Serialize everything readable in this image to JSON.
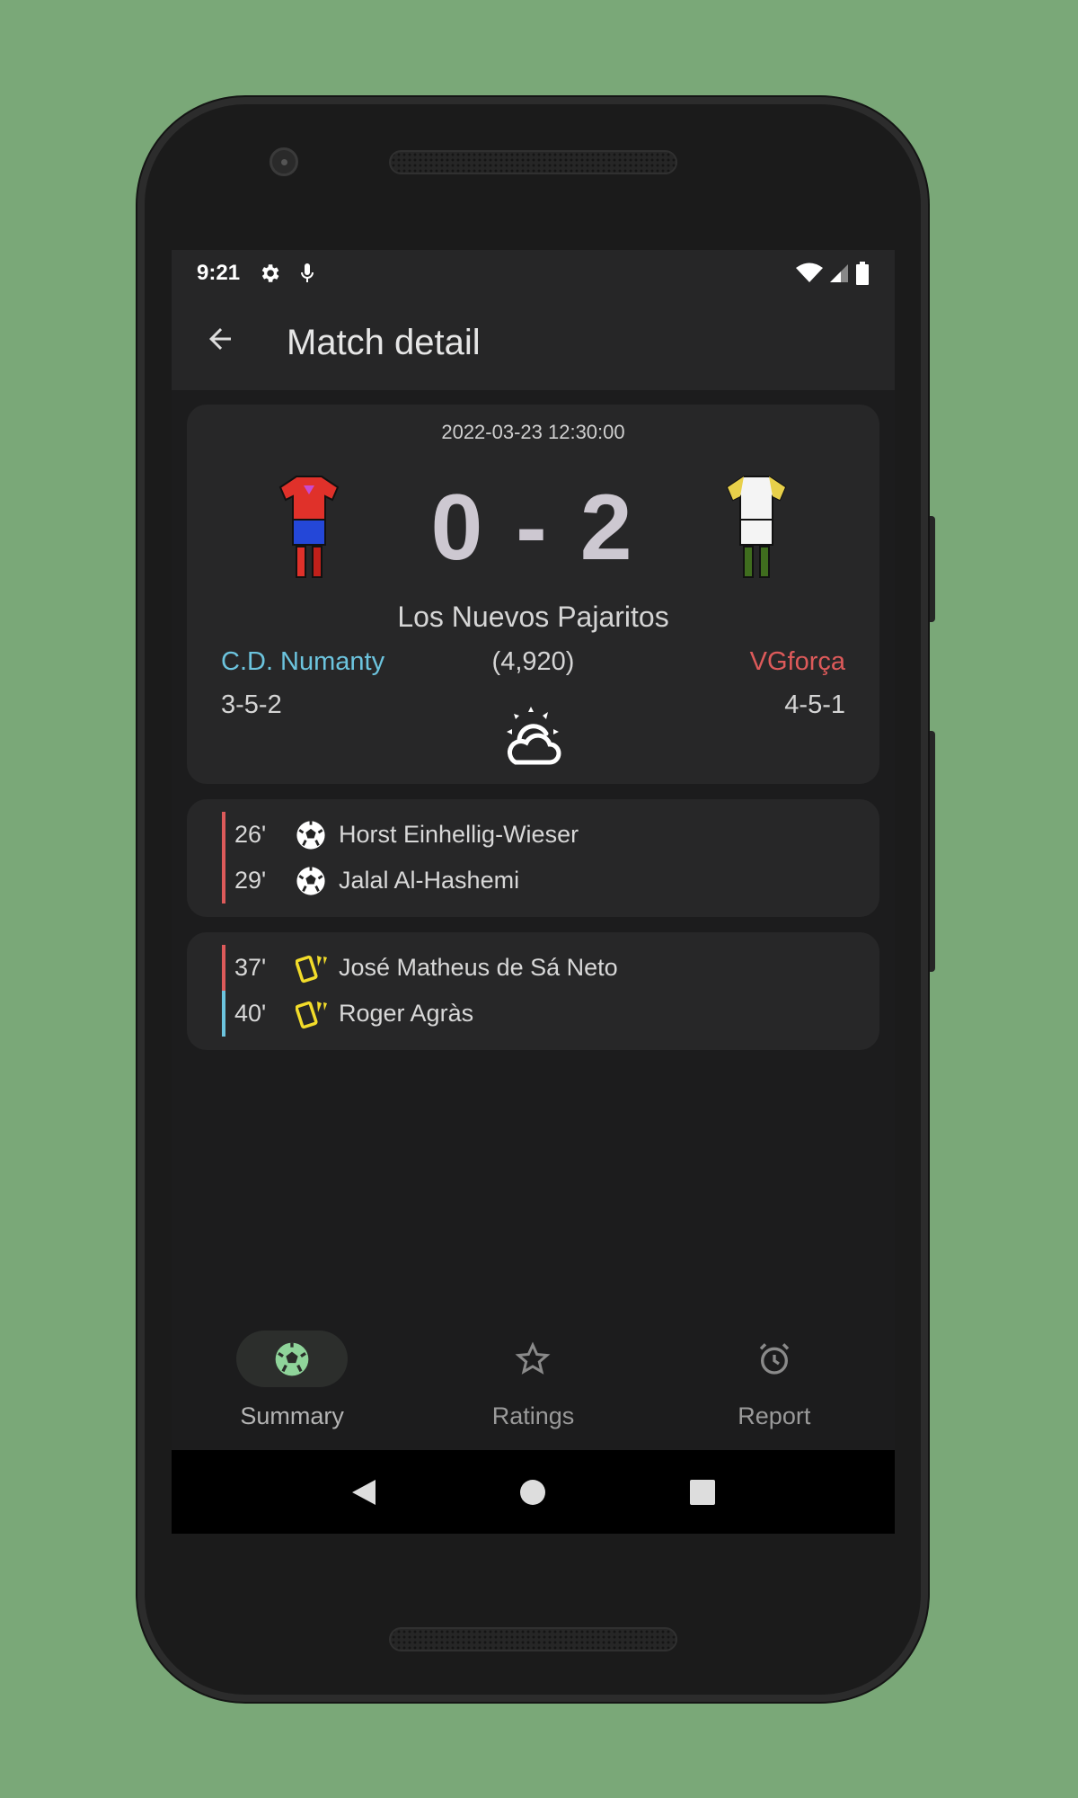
{
  "status_bar": {
    "time": "9:21",
    "icons": [
      "settings-icon",
      "mic-icon",
      "wifi-icon",
      "signal-icon",
      "battery-icon"
    ]
  },
  "app_bar": {
    "title": "Match detail",
    "back_icon": "arrow-left-icon"
  },
  "match": {
    "datetime": "2022-03-23 12:30:00",
    "score": "0 - 2",
    "venue": "Los Nuevos Pajaritos",
    "attendance": "(4,920)",
    "home": {
      "name": "C.D. Numanty",
      "formation": "3-5-2",
      "color": "#6cc4de"
    },
    "away": {
      "name": "VGforça",
      "formation": "4-5-1",
      "color": "#dd5a5a"
    },
    "weather_icon": "partly-cloudy-icon"
  },
  "goals": [
    {
      "minute": "26'",
      "player": "Horst Einhellig-Wieser",
      "side": "away",
      "icon": "soccer-ball-icon"
    },
    {
      "minute": "29'",
      "player": "Jalal Al-Hashemi",
      "side": "away",
      "icon": "soccer-ball-icon"
    }
  ],
  "cards": [
    {
      "minute": "37'",
      "player": "José Matheus de Sá Neto",
      "side": "away",
      "icon": "yellow-card-icon"
    },
    {
      "minute": "40'",
      "player": "Roger Agràs",
      "side": "home",
      "icon": "yellow-card-icon"
    }
  ],
  "bottom_nav": [
    {
      "label": "Summary",
      "icon": "soccer-ball-icon",
      "selected": true
    },
    {
      "label": "Ratings",
      "icon": "star-icon",
      "selected": false
    },
    {
      "label": "Report",
      "icon": "alarm-clock-icon",
      "selected": false
    }
  ],
  "colors": {
    "accent": "#8fd49a",
    "card_yellow": "#f2dc2a",
    "background": "#7aa878"
  }
}
